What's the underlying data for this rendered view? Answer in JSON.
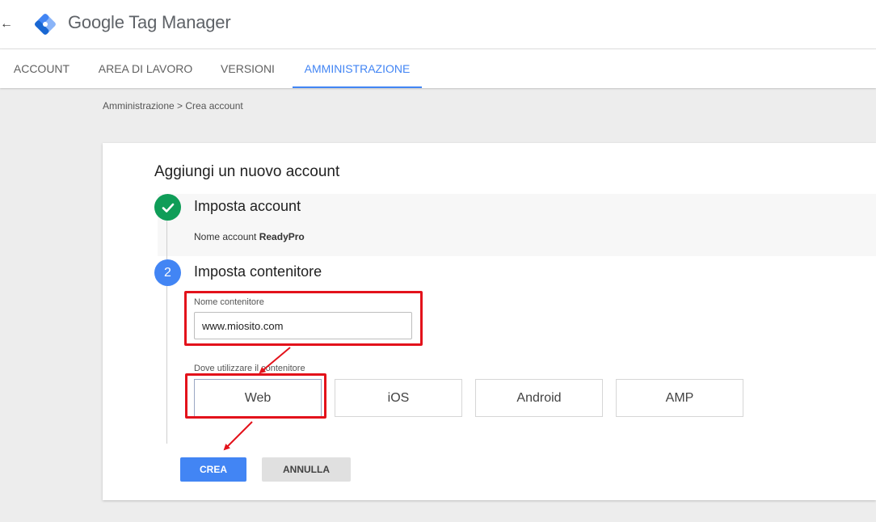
{
  "header": {
    "back_icon": "arrow-back-icon",
    "logo_icon": "tag-manager-logo-icon",
    "app_title": "Google Tag Manager"
  },
  "tabs": [
    {
      "label": "ACCOUNT",
      "active": false
    },
    {
      "label": "AREA DI LAVORO",
      "active": false
    },
    {
      "label": "VERSIONI",
      "active": false
    },
    {
      "label": "AMMINISTRAZIONE",
      "active": true
    }
  ],
  "breadcrumb": "Amministrazione > Crea account",
  "card": {
    "title": "Aggiungi un nuovo account",
    "step1": {
      "icon": "checkmark-icon",
      "title": "Imposta account",
      "summary_label": "Nome account",
      "summary_value": "ReadyPro"
    },
    "step2": {
      "number": "2",
      "title": "Imposta contenitore",
      "container_name_label": "Nome contenitore",
      "container_name_value": "www.miosito.com",
      "target_label": "Dove utilizzare il contenitore",
      "targets": [
        "Web",
        "iOS",
        "Android",
        "AMP"
      ],
      "selected_target": "Web"
    },
    "create_label": "CREA",
    "cancel_label": "ANNULLA"
  },
  "annotation_color": "#e3121b",
  "colors": {
    "accent": "#4285f4",
    "success": "#0f9d58"
  }
}
